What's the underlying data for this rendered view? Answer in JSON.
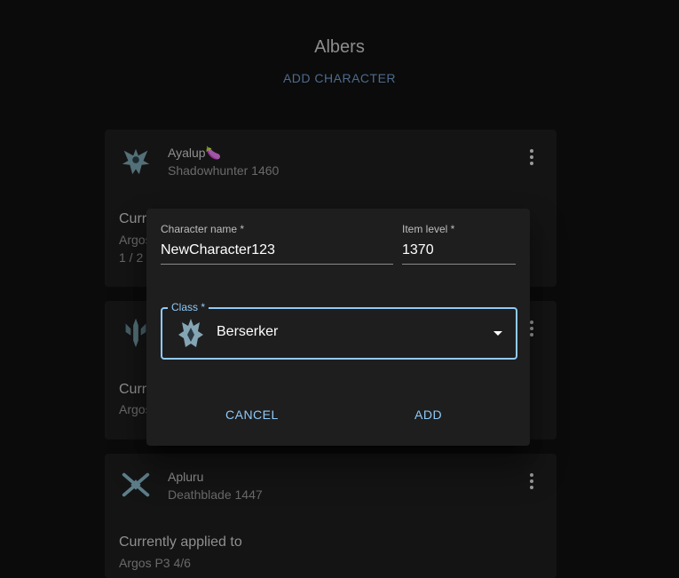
{
  "roster": {
    "title": "Albers",
    "add_character_label": "ADD CHARACTER"
  },
  "characters": [
    {
      "name": "Ayalup",
      "emoji": "🍆",
      "class_level": "Shadowhunter 1460",
      "icon": "shadowhunter-class-icon",
      "applied_label": "Curr",
      "raid": "Argos",
      "count": "1 / 2"
    },
    {
      "icon": "gunlancer-class-icon",
      "applied_label": "Curr",
      "raid": "Argos"
    },
    {
      "name": "Apluru",
      "class_level": "Deathblade 1447",
      "icon": "deathblade-class-icon",
      "applied_label": "Currently applied to",
      "raid": "Argos P3 4/6"
    }
  ],
  "dialog": {
    "character_name": {
      "label": "Character name *",
      "value": "NewCharacter123"
    },
    "item_level": {
      "label": "Item level *",
      "value": "1370"
    },
    "class_select": {
      "label": "Class *",
      "value": "Berserker",
      "icon": "berserker-class-icon"
    },
    "cancel_label": "CANCEL",
    "add_label": "ADD"
  },
  "colors": {
    "background": "#0b0b0b",
    "card": "#141414",
    "dialog": "#1e1e1e",
    "accent": "#90caf9",
    "muted_accent": "#4d6b8c"
  }
}
